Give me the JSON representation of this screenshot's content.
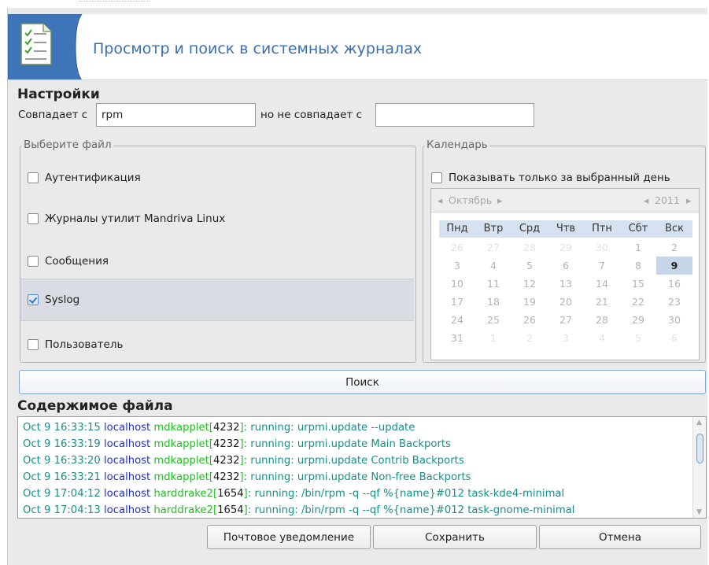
{
  "header": {
    "title": "Просмотр и поиск в системных журналах",
    "icon": "document-checklist-icon"
  },
  "settings": {
    "title": "Настройки",
    "match_label": "Совпадает с",
    "match_value": "rpm",
    "nomatch_label": "но не совпадает с",
    "nomatch_value": ""
  },
  "file_group": {
    "legend": "Выберите файл",
    "items": [
      {
        "label": "Аутентификация",
        "checked": false
      },
      {
        "label": "Журналы утилит Mandriva Linux",
        "checked": false
      },
      {
        "label": "Сообщения",
        "checked": false
      },
      {
        "label": "Syslog",
        "checked": true
      },
      {
        "label": "Пользователь",
        "checked": false
      }
    ]
  },
  "calendar": {
    "legend": "Календарь",
    "only_day_label": "Показывать только за выбранный день",
    "only_day_checked": false,
    "month": "Октябрь",
    "year": "2011",
    "weekdays": [
      "Пнд",
      "Втр",
      "Срд",
      "Чтв",
      "Птн",
      "Сбт",
      "Вск"
    ],
    "weeks": [
      [
        "26",
        "27",
        "28",
        "29",
        "30",
        "1",
        "2"
      ],
      [
        "3",
        "4",
        "5",
        "6",
        "7",
        "8",
        "9"
      ],
      [
        "10",
        "11",
        "12",
        "13",
        "14",
        "15",
        "16"
      ],
      [
        "17",
        "18",
        "19",
        "20",
        "21",
        "22",
        "23"
      ],
      [
        "24",
        "25",
        "26",
        "27",
        "28",
        "29",
        "30"
      ],
      [
        "31",
        "1",
        "2",
        "3",
        "4",
        "5",
        "6"
      ]
    ],
    "selected_day": "9"
  },
  "search_button": "Поиск",
  "content": {
    "title": "Содержимое файла",
    "lines": [
      {
        "date": "Oct  9 16:33:15",
        "host": "localhost",
        "prog": "mdkapplet",
        "pid": "4232",
        "msg": ": running: urpmi.update --update"
      },
      {
        "date": "Oct  9 16:33:19",
        "host": "localhost",
        "prog": "mdkapplet",
        "pid": "4232",
        "msg": ": running: urpmi.update Main Backports"
      },
      {
        "date": "Oct  9 16:33:20",
        "host": "localhost",
        "prog": "mdkapplet",
        "pid": "4232",
        "msg": ": running: urpmi.update Contrib Backports"
      },
      {
        "date": "Oct  9 16:33:21",
        "host": "localhost",
        "prog": "mdkapplet",
        "pid": "4232",
        "msg": ": running: urpmi.update Non-free Backports"
      },
      {
        "date": "Oct  9 17:04:12",
        "host": "localhost",
        "prog": "harddrake2",
        "pid": "1654",
        "msg": ": running: /bin/rpm -q --qf %{name}#012 task-kde4-minimal"
      },
      {
        "date": "Oct  9 17:04:13",
        "host": "localhost",
        "prog": "harddrake2",
        "pid": "1654",
        "msg": ": running: /bin/rpm -q --qf %{name}#012 task-gnome-minimal"
      }
    ]
  },
  "buttons": {
    "mail": "Почтовое уведомление",
    "save": "Сохранить",
    "cancel": "Отмена"
  },
  "colors": {
    "accent": "#3b6fae",
    "header_band": "#3e74b8",
    "log_date": "#17908a",
    "log_host": "#1f2fcc",
    "log_prog": "#1fc01f"
  }
}
